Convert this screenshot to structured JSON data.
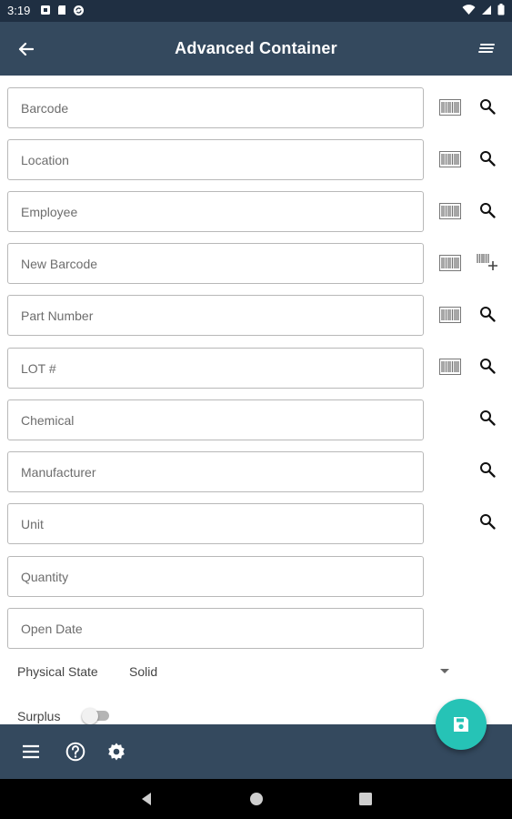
{
  "status_bar": {
    "time": "3:19",
    "left_icons": [
      "notification-icon",
      "sd-card-icon",
      "sync-icon"
    ],
    "right_icons": [
      "wifi-icon",
      "no-sim-icon",
      "battery-icon"
    ]
  },
  "app_bar": {
    "title": "Advanced Container",
    "back_icon": "arrow-back-icon",
    "menu_icon": "menu-list-icon"
  },
  "fields": [
    {
      "placeholder": "Barcode",
      "value": "",
      "barcode": true,
      "action": "search"
    },
    {
      "placeholder": "Location",
      "value": "",
      "barcode": true,
      "action": "search"
    },
    {
      "placeholder": "Employee",
      "value": "",
      "barcode": true,
      "action": "search"
    },
    {
      "placeholder": "New Barcode",
      "value": "",
      "barcode": true,
      "action": "add-barcode"
    },
    {
      "placeholder": "Part Number",
      "value": "",
      "barcode": true,
      "action": "search"
    },
    {
      "placeholder": "LOT #",
      "value": "",
      "barcode": true,
      "action": "search"
    },
    {
      "placeholder": "Chemical",
      "value": "",
      "barcode": false,
      "action": "search"
    },
    {
      "placeholder": "Manufacturer",
      "value": "",
      "barcode": false,
      "action": "search"
    },
    {
      "placeholder": "Unit",
      "value": "",
      "barcode": false,
      "action": "search"
    },
    {
      "placeholder": "Quantity",
      "value": "",
      "barcode": false,
      "action": "none"
    },
    {
      "placeholder": "Open Date",
      "value": "",
      "barcode": false,
      "action": "none"
    }
  ],
  "physical_state": {
    "label": "Physical State",
    "value": "Solid"
  },
  "surplus": {
    "label": "Surplus",
    "checked": false
  },
  "bottom_bar": {
    "icons": [
      "hamburger-menu-icon",
      "help-icon",
      "settings-icon"
    ]
  },
  "fab": {
    "icon": "save-icon"
  },
  "nav_bar": {
    "icons": [
      "back-triangle-icon",
      "home-circle-icon",
      "recents-square-icon"
    ]
  },
  "colors": {
    "app_bar": "#34495e",
    "status_bar": "#1f2f42",
    "accent": "#26c3b6",
    "field_border": "#b8b8b8"
  }
}
